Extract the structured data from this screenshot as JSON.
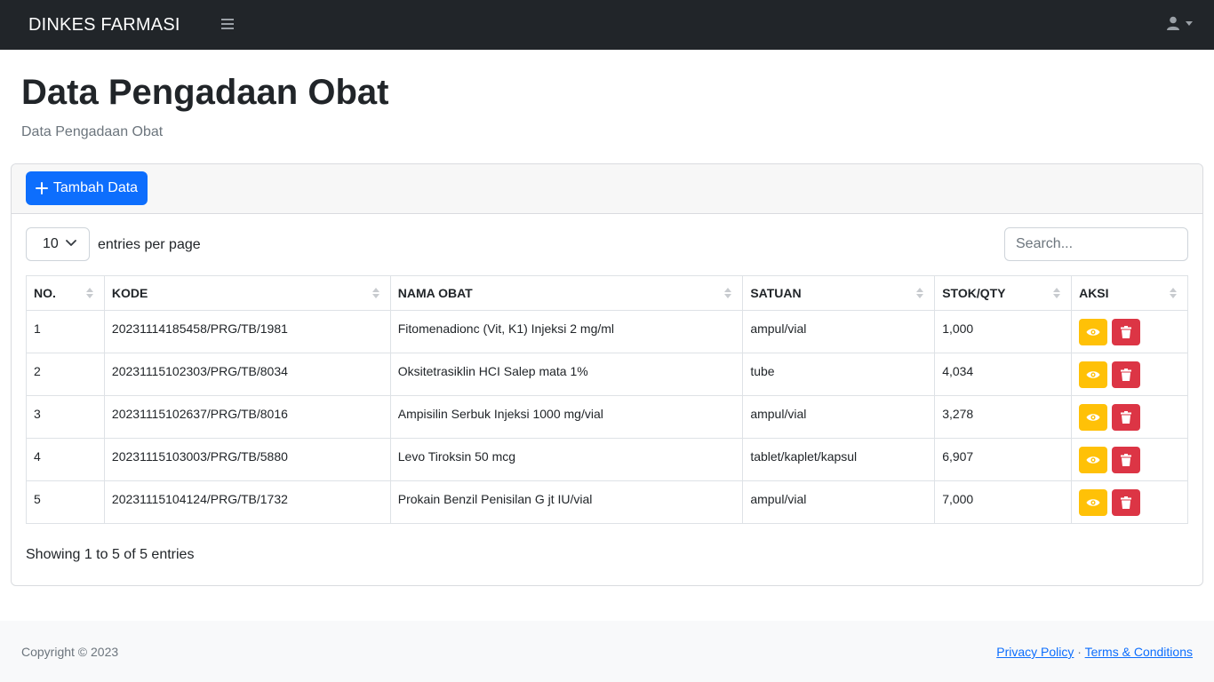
{
  "navbar": {
    "brand": "DINKES FARMASI",
    "menu_icon": "hamburger-icon",
    "user_icon": "user-icon"
  },
  "page": {
    "title": "Data Pengadaan Obat",
    "subtitle": "Data Pengadaan Obat"
  },
  "toolbar": {
    "add_label": "Tambah Data"
  },
  "datatable": {
    "per_page_value": "10",
    "per_page_label": "entries per page",
    "search_placeholder": "Search...",
    "columns": [
      "NO.",
      "KODE",
      "NAMA OBAT",
      "SATUAN",
      "STOK/QTY",
      "AKSI"
    ],
    "rows": [
      {
        "no": "1",
        "kode": "20231114185458/PRG/TB/1981",
        "nama": "Fitomenadionc (Vit, K1) Injeksi 2 mg/ml",
        "satuan": "ampul/vial",
        "stok": "1,000"
      },
      {
        "no": "2",
        "kode": "20231115102303/PRG/TB/8034",
        "nama": "Oksitetrasiklin HCI Salep mata 1%",
        "satuan": "tube",
        "stok": "4,034"
      },
      {
        "no": "3",
        "kode": "20231115102637/PRG/TB/8016",
        "nama": "Ampisilin Serbuk Injeksi 1000 mg/vial",
        "satuan": "ampul/vial",
        "stok": "3,278"
      },
      {
        "no": "4",
        "kode": "20231115103003/PRG/TB/5880",
        "nama": "Levo Tiroksin 50 mcg",
        "satuan": "tablet/kaplet/kapsul",
        "stok": "6,907"
      },
      {
        "no": "5",
        "kode": "20231115104124/PRG/TB/1732",
        "nama": "Prokain Benzil Penisilan G jt IU/vial",
        "satuan": "ampul/vial",
        "stok": "7,000"
      }
    ],
    "showing_text": "Showing 1 to 5 of 5 entries"
  },
  "footer": {
    "copyright": "Copyright © 2023",
    "privacy": "Privacy Policy",
    "separator": "·",
    "terms": "Terms & Conditions"
  },
  "colors": {
    "navbar": "#212529",
    "primary": "#0d6efd",
    "warning": "#ffc107",
    "danger": "#dc3545"
  }
}
